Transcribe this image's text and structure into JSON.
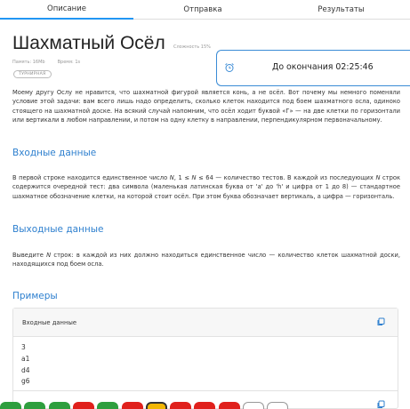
{
  "tabs": [
    {
      "label": "Описание",
      "active": true
    },
    {
      "label": "Отправка",
      "active": false
    },
    {
      "label": "Результаты",
      "active": false
    }
  ],
  "problem": {
    "title": "Шахматный Осёл",
    "difficulty": "Сложность 15%",
    "memory": "Память: 16Mb",
    "time": "Время: 1s",
    "badge": "ТУРНИРНАЯ"
  },
  "timer": {
    "label": "До окончания 02:25:46",
    "icon": "alarm-clock-icon"
  },
  "statement": {
    "intro": "Моему другу Ослу не нравится, что шахматной фигурой является конь, а не осёл. Вот почему мы немного поменяли условие этой задачи: вам всего лишь надо определить, сколько клеток находится под боем шахматного осла, одиноко стоящего на шахматной доске. На всякий случай напомним, что осёл ходит буквой «Г» — на две клетки по горизонтали или вертикали в любом направлении, и потом на одну клетку в направлении, перпендикулярном первоначальному.",
    "input_heading": "Входные данные",
    "input_text_1": "В первой строке находится единственное число ",
    "input_var_n": "N",
    "input_text_2": ", 1 ≤ ",
    "input_var_n2": "N",
    "input_text_3": " ≤ 64 — количество тестов. В каждой из последующих ",
    "input_var_n3": "N",
    "input_text_4": " строк содержится очередной тест: два символа (маленькая латинская буква от 'a' до 'h' и цифра от 1 до 8) — стандартное шахматное обозначение клетки, на которой стоит осёл. При этом буква обозначает вертикаль, а цифра — горизонталь.",
    "output_heading": "Выходные данные",
    "output_text_1": "Выведите ",
    "output_var_n": "N",
    "output_text_2": " строк: в каждой из них должно находиться единственное число — количество клеток шахматной доски, находящихся под боем осла."
  },
  "examples": {
    "heading": "Примеры",
    "input_title": "Входные данные",
    "input_lines": [
      "3",
      "a1",
      "d4",
      "g6"
    ],
    "copy_icon": "copy-icon"
  },
  "status_chips": [
    {
      "color": "#2e9e3e",
      "style": "filled"
    },
    {
      "color": "#2e9e3e",
      "style": "filled"
    },
    {
      "color": "#2e9e3e",
      "style": "filled"
    },
    {
      "color": "#e0201c",
      "style": "filled"
    },
    {
      "color": "#2e9e3e",
      "style": "filled"
    },
    {
      "color": "#e0201c",
      "style": "filled"
    },
    {
      "color": "#f2b705",
      "style": "selected"
    },
    {
      "color": "#e0201c",
      "style": "filled"
    },
    {
      "color": "#e0201c",
      "style": "filled"
    },
    {
      "color": "#e0201c",
      "style": "filled"
    },
    {
      "color": "#ffffff",
      "style": "outline"
    },
    {
      "color": "#ffffff",
      "style": "outline"
    }
  ],
  "colors": {
    "accent": "#2f80cf",
    "tab_active": "#2196f3",
    "timer_border": "#3b8cd6"
  }
}
